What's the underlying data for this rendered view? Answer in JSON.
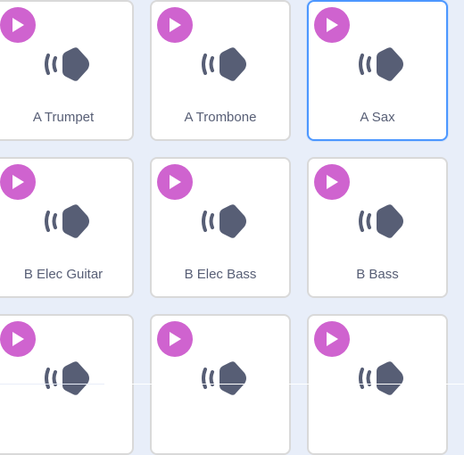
{
  "colors": {
    "background": "#e8eef9",
    "tile_background": "#ffffff",
    "tile_border": "#d9d9d9",
    "selected_border": "#4c97ff",
    "play_button": "#cf63cf",
    "icon": "#575e75"
  },
  "icons": {
    "play": "play-icon",
    "sound": "sound-speaker-icon"
  },
  "sounds": [
    {
      "label": "A Trumpet",
      "selected": false
    },
    {
      "label": "A Trombone",
      "selected": false
    },
    {
      "label": "A Sax",
      "selected": true
    },
    {
      "label": "B Elec Guitar",
      "selected": false
    },
    {
      "label": "B Elec Bass",
      "selected": false
    },
    {
      "label": "B Bass",
      "selected": false
    },
    {
      "label": "",
      "selected": false
    },
    {
      "label": "",
      "selected": false
    },
    {
      "label": "",
      "selected": false
    }
  ]
}
